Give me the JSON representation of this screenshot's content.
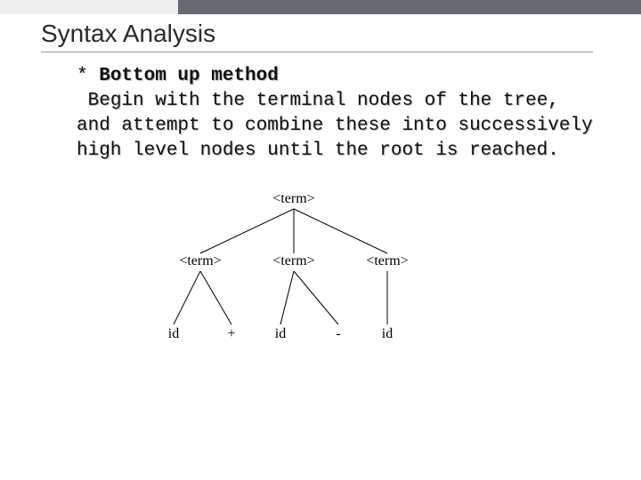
{
  "title": "Syntax Analysis",
  "bullet": "*",
  "heading": "Bottom up method",
  "body": "Begin with the terminal nodes of the tree, and attempt to combine these into successively high level nodes until the root is reached.",
  "tree": {
    "root": "<term>",
    "mid": [
      "<term>",
      "<term>",
      "<term>"
    ],
    "leaves": [
      "id",
      "+",
      "id",
      "-",
      "id"
    ]
  }
}
